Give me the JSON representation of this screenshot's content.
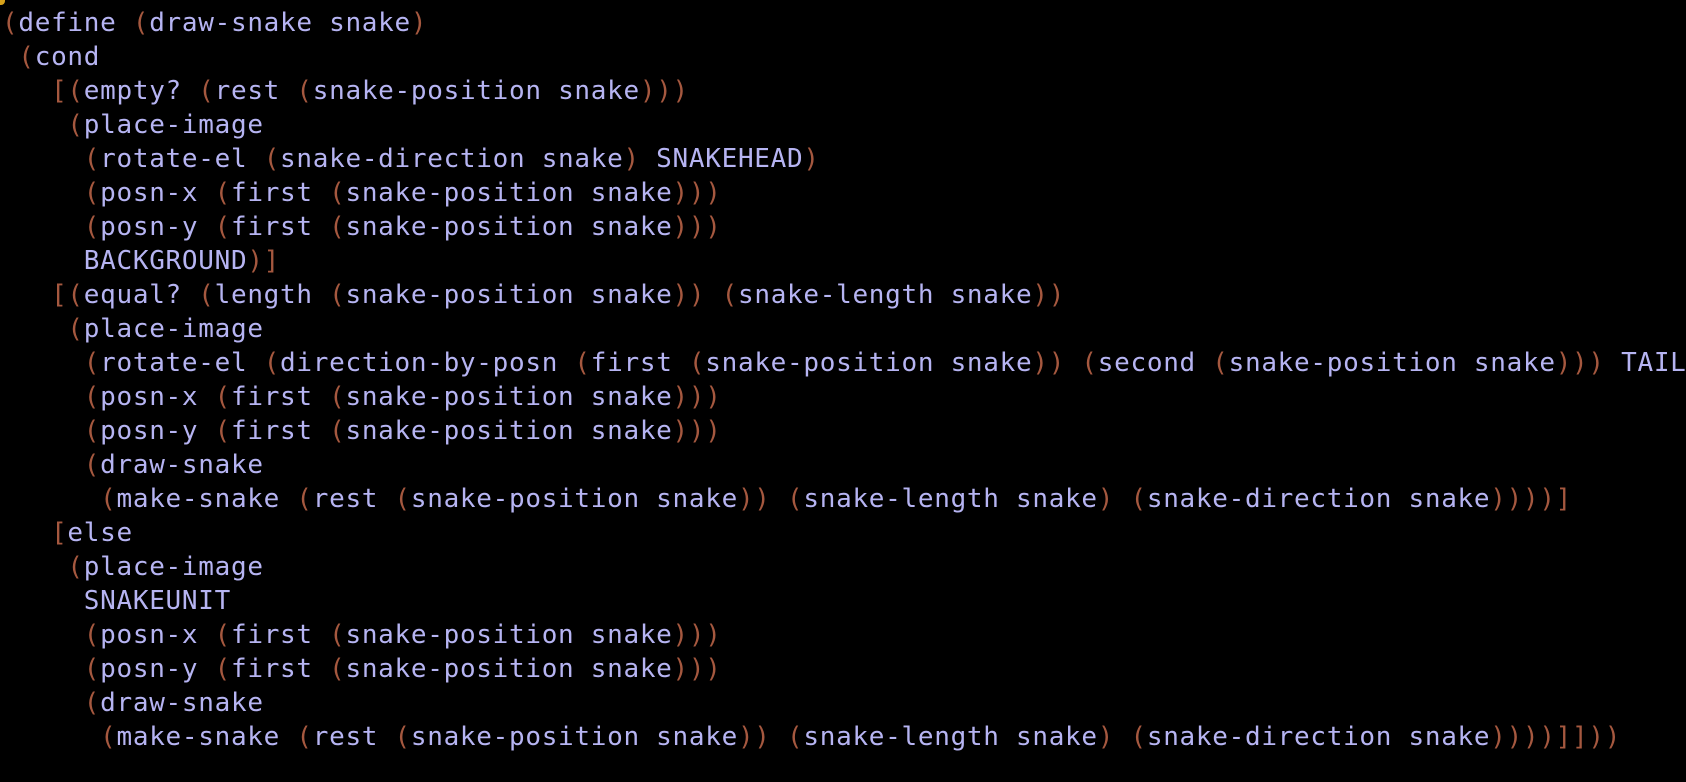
{
  "editor": {
    "colors": {
      "background": "#000000",
      "text": "#b6b4f2",
      "paren": "#a5583f",
      "cursor": "#d7a21b"
    },
    "lines": [
      {
        "indent": "",
        "tokens": [
          [
            "p",
            "("
          ],
          [
            "t",
            "define "
          ],
          [
            "p",
            "("
          ],
          [
            "t",
            "draw-snake snake"
          ],
          [
            "p",
            ")"
          ]
        ]
      },
      {
        "indent": " ",
        "tokens": [
          [
            "p",
            "("
          ],
          [
            "t",
            "cond"
          ]
        ]
      },
      {
        "indent": "   ",
        "tokens": [
          [
            "p",
            "[("
          ],
          [
            "t",
            "empty? "
          ],
          [
            "p",
            "("
          ],
          [
            "t",
            "rest "
          ],
          [
            "p",
            "("
          ],
          [
            "t",
            "snake-position snake"
          ],
          [
            "p",
            ")))"
          ]
        ]
      },
      {
        "indent": "    ",
        "tokens": [
          [
            "p",
            "("
          ],
          [
            "t",
            "place-image"
          ]
        ]
      },
      {
        "indent": "     ",
        "tokens": [
          [
            "p",
            "("
          ],
          [
            "t",
            "rotate-el "
          ],
          [
            "p",
            "("
          ],
          [
            "t",
            "snake-direction snake"
          ],
          [
            "p",
            ")"
          ],
          [
            "t",
            " SNAKEHEAD"
          ],
          [
            "p",
            ")"
          ]
        ]
      },
      {
        "indent": "     ",
        "tokens": [
          [
            "p",
            "("
          ],
          [
            "t",
            "posn-x "
          ],
          [
            "p",
            "("
          ],
          [
            "t",
            "first "
          ],
          [
            "p",
            "("
          ],
          [
            "t",
            "snake-position snake"
          ],
          [
            "p",
            ")))"
          ]
        ]
      },
      {
        "indent": "     ",
        "tokens": [
          [
            "p",
            "("
          ],
          [
            "t",
            "posn-y "
          ],
          [
            "p",
            "("
          ],
          [
            "t",
            "first "
          ],
          [
            "p",
            "("
          ],
          [
            "t",
            "snake-position snake"
          ],
          [
            "p",
            ")))"
          ]
        ]
      },
      {
        "indent": "     ",
        "tokens": [
          [
            "t",
            "BACKGROUND"
          ],
          [
            "p",
            ")]"
          ]
        ]
      },
      {
        "indent": "   ",
        "tokens": [
          [
            "p",
            "[("
          ],
          [
            "t",
            "equal? "
          ],
          [
            "p",
            "("
          ],
          [
            "t",
            "length "
          ],
          [
            "p",
            "("
          ],
          [
            "t",
            "snake-position snake"
          ],
          [
            "p",
            "))"
          ],
          [
            "t",
            " "
          ],
          [
            "p",
            "("
          ],
          [
            "t",
            "snake-length snake"
          ],
          [
            "p",
            "))"
          ]
        ]
      },
      {
        "indent": "    ",
        "tokens": [
          [
            "p",
            "("
          ],
          [
            "t",
            "place-image"
          ]
        ]
      },
      {
        "indent": "     ",
        "tokens": [
          [
            "p",
            "("
          ],
          [
            "t",
            "rotate-el "
          ],
          [
            "p",
            "("
          ],
          [
            "t",
            "direction-by-posn "
          ],
          [
            "p",
            "("
          ],
          [
            "t",
            "first "
          ],
          [
            "p",
            "("
          ],
          [
            "t",
            "snake-position snake"
          ],
          [
            "p",
            "))"
          ],
          [
            "t",
            " "
          ],
          [
            "p",
            "("
          ],
          [
            "t",
            "second "
          ],
          [
            "p",
            "("
          ],
          [
            "t",
            "snake-position snake"
          ],
          [
            "p",
            ")))"
          ],
          [
            "t",
            " TAIL"
          ],
          [
            "p",
            ")"
          ]
        ]
      },
      {
        "indent": "     ",
        "tokens": [
          [
            "p",
            "("
          ],
          [
            "t",
            "posn-x "
          ],
          [
            "p",
            "("
          ],
          [
            "t",
            "first "
          ],
          [
            "p",
            "("
          ],
          [
            "t",
            "snake-position snake"
          ],
          [
            "p",
            ")))"
          ]
        ]
      },
      {
        "indent": "     ",
        "tokens": [
          [
            "p",
            "("
          ],
          [
            "t",
            "posn-y "
          ],
          [
            "p",
            "("
          ],
          [
            "t",
            "first "
          ],
          [
            "p",
            "("
          ],
          [
            "t",
            "snake-position snake"
          ],
          [
            "p",
            ")))"
          ]
        ]
      },
      {
        "indent": "     ",
        "tokens": [
          [
            "p",
            "("
          ],
          [
            "t",
            "draw-snake"
          ]
        ]
      },
      {
        "indent": "      ",
        "tokens": [
          [
            "p",
            "("
          ],
          [
            "t",
            "make-snake "
          ],
          [
            "p",
            "("
          ],
          [
            "t",
            "rest "
          ],
          [
            "p",
            "("
          ],
          [
            "t",
            "snake-position snake"
          ],
          [
            "p",
            "))"
          ],
          [
            "t",
            " "
          ],
          [
            "p",
            "("
          ],
          [
            "t",
            "snake-length snake"
          ],
          [
            "p",
            ")"
          ],
          [
            "t",
            " "
          ],
          [
            "p",
            "("
          ],
          [
            "t",
            "snake-direction snake"
          ],
          [
            "p",
            "))))]"
          ]
        ]
      },
      {
        "indent": "   ",
        "tokens": [
          [
            "p",
            "["
          ],
          [
            "t",
            "else"
          ]
        ]
      },
      {
        "indent": "    ",
        "tokens": [
          [
            "p",
            "("
          ],
          [
            "t",
            "place-image"
          ]
        ]
      },
      {
        "indent": "     ",
        "tokens": [
          [
            "t",
            "SNAKEUNIT"
          ]
        ]
      },
      {
        "indent": "     ",
        "tokens": [
          [
            "p",
            "("
          ],
          [
            "t",
            "posn-x "
          ],
          [
            "p",
            "("
          ],
          [
            "t",
            "first "
          ],
          [
            "p",
            "("
          ],
          [
            "t",
            "snake-position snake"
          ],
          [
            "p",
            ")))"
          ]
        ]
      },
      {
        "indent": "     ",
        "tokens": [
          [
            "p",
            "("
          ],
          [
            "t",
            "posn-y "
          ],
          [
            "p",
            "("
          ],
          [
            "t",
            "first "
          ],
          [
            "p",
            "("
          ],
          [
            "t",
            "snake-position snake"
          ],
          [
            "p",
            ")))"
          ]
        ]
      },
      {
        "indent": "     ",
        "tokens": [
          [
            "p",
            "("
          ],
          [
            "t",
            "draw-snake"
          ]
        ]
      },
      {
        "indent": "      ",
        "tokens": [
          [
            "p",
            "("
          ],
          [
            "t",
            "make-snake "
          ],
          [
            "p",
            "("
          ],
          [
            "t",
            "rest "
          ],
          [
            "p",
            "("
          ],
          [
            "t",
            "snake-position snake"
          ],
          [
            "p",
            "))"
          ],
          [
            "t",
            " "
          ],
          [
            "p",
            "("
          ],
          [
            "t",
            "snake-length snake"
          ],
          [
            "p",
            ")"
          ],
          [
            "t",
            " "
          ],
          [
            "p",
            "("
          ],
          [
            "t",
            "snake-direction snake"
          ],
          [
            "p",
            "))))]]))"
          ]
        ]
      }
    ]
  }
}
